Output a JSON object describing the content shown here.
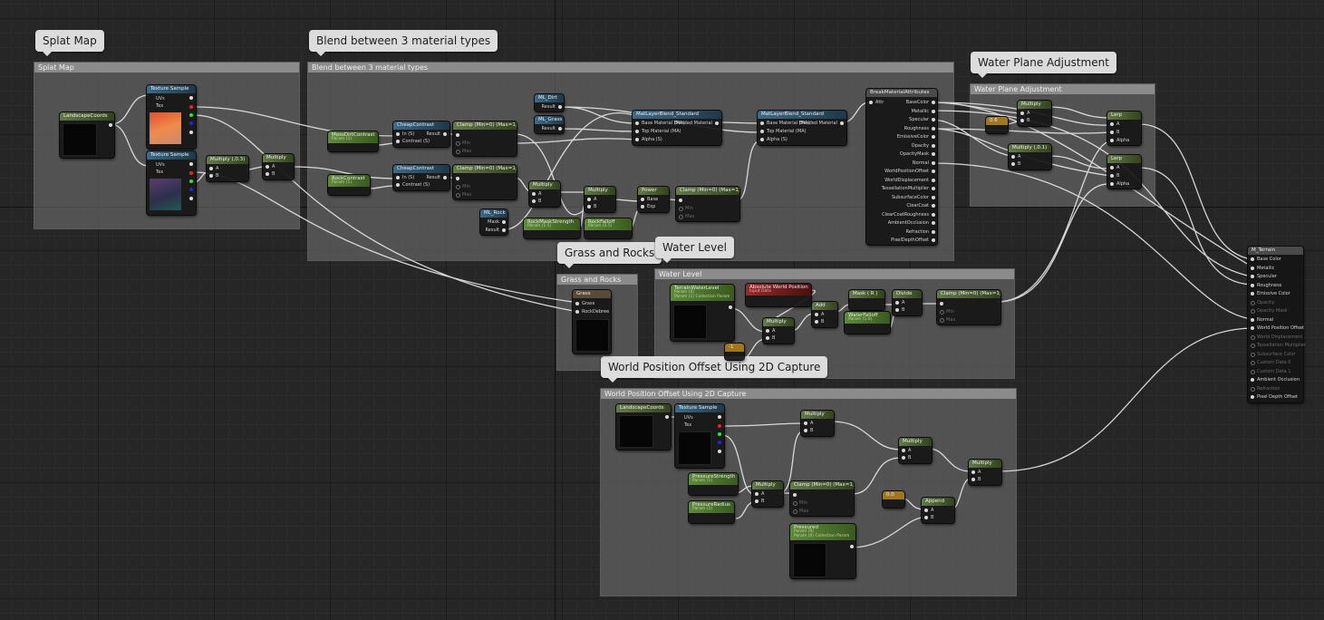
{
  "comments": [
    {
      "title": "Splat Map"
    },
    {
      "title": "Blend between 3 material types"
    },
    {
      "title": "Water Plane Adjustment"
    },
    {
      "title": "Grass and Rocks"
    },
    {
      "title": "Water Level"
    },
    {
      "title": "World Position Offset Using 2D Capture"
    }
  ],
  "nodes": {
    "landscape_coords_1": {
      "title": "LandscapeCoords"
    },
    "tex_sample_1": {
      "title": "Texture Sample",
      "pins": [
        "UVs",
        "Tex"
      ]
    },
    "tex_sample_2": {
      "title": "Texture Sample",
      "pins": [
        "UVs",
        "Tex"
      ]
    },
    "multiply_03": {
      "title": "Multiply (,0.3)",
      "pins": [
        "A",
        "B"
      ]
    },
    "multiply_splat": {
      "title": "Multiply",
      "pins": [
        "A",
        "B"
      ]
    },
    "moss_dirt_contrast": {
      "title": "MossDirtContrast",
      "sub": "Param (1)"
    },
    "rock_contrast": {
      "title": "RockContrast",
      "sub": "Param (1)"
    },
    "cheap_contrast_1": {
      "title": "CheapContrast",
      "pins": [
        "In (S)",
        "Contrast (S)"
      ],
      "out": "Result"
    },
    "cheap_contrast_2": {
      "title": "CheapContrast",
      "pins": [
        "In (S)",
        "Contrast (S)"
      ],
      "out": "Result"
    },
    "clamp_1": {
      "title": "Clamp (Min=0) (Max=1)",
      "pins": [
        "Min",
        "Max"
      ]
    },
    "clamp_2": {
      "title": "Clamp (Min=0) (Max=1)",
      "pins": [
        "Min",
        "Max"
      ]
    },
    "ml_dirt": {
      "title": "ML_Dirt",
      "out": "Result"
    },
    "ml_grass": {
      "title": "ML_Grass",
      "out": "Result"
    },
    "ml_rock": {
      "title": "ML_Rock",
      "pins": [
        "Mask",
        "Result"
      ]
    },
    "multiply_b1": {
      "title": "Multiply",
      "pins": [
        "A",
        "B"
      ]
    },
    "multiply_b2": {
      "title": "Multiply",
      "pins": [
        "A",
        "B"
      ]
    },
    "power": {
      "title": "Power",
      "pins": [
        "Base",
        "Exp"
      ]
    },
    "clamp_3": {
      "title": "Clamp (Min=0) (Max=1)",
      "pins": [
        "Min",
        "Max"
      ]
    },
    "rock_mask_strength": {
      "title": "RockMaskStrength",
      "sub": "Param (1.5)"
    },
    "rock_falloff": {
      "title": "RockFalloff",
      "sub": "Param (2.5)"
    },
    "mat_layer_blend_1": {
      "title": "MatLayerBlend_Standard",
      "pins": [
        "Base Material (MA)",
        "Top Material (MA)",
        "Alpha (S)"
      ],
      "out": "Blended Material"
    },
    "mat_layer_blend_2": {
      "title": "MatLayerBlend_Standard",
      "pins": [
        "Base Material (MA)",
        "Top Material (MA)",
        "Alpha (S)"
      ],
      "out": "Blended Material"
    },
    "break_material": {
      "title": "BreakMaterialAttributes",
      "in": "Attr",
      "pins": [
        "BaseColor",
        "Metallic",
        "Specular",
        "Roughness",
        "EmissiveColor",
        "Opacity",
        "OpacityMask",
        "Normal",
        "WorldPositionOffset",
        "WorldDisplacement",
        "TessellationMultiplier",
        "SubsurfaceColor",
        "ClearCoat",
        "ClearCoatRoughness",
        "AmbientOcclusion",
        "Refraction",
        "PixelDepthOffset"
      ]
    },
    "const_06": {
      "title": "0.6"
    },
    "multiply_w1": {
      "title": "Multiply",
      "pins": [
        "A",
        "B"
      ]
    },
    "multiply_w2": {
      "title": "Multiply (,0.1)",
      "pins": [
        "A",
        "B"
      ]
    },
    "lerp_1": {
      "title": "Lerp",
      "pins": [
        "A",
        "B",
        "Alpha"
      ]
    },
    "lerp_2": {
      "title": "Lerp",
      "pins": [
        "A",
        "B",
        "Alpha"
      ]
    },
    "m_terrain": {
      "title": "M_Terrain",
      "pins": [
        "Base Color",
        "Metallic",
        "Specular",
        "Roughness",
        "Emissive Color",
        "Opacity",
        "Opacity Mask",
        "Normal",
        "World Position Offset",
        "World Displacement",
        "Tessellation Multiplier",
        "Subsurface Color",
        "Custom Data 0",
        "Custom Data 1",
        "Ambient Occlusion",
        "Refraction",
        "Pixel Depth Offset"
      ]
    },
    "grass": {
      "title": "Grass",
      "pins": [
        "Grass",
        "RockDebree"
      ]
    },
    "terrain_water_level": {
      "title": "TerrainWaterLevel",
      "sub": "Param (0)",
      "sub2": "Param (1) Collection Param"
    },
    "abs_world_pos": {
      "title": "Absolute World Position",
      "sub": "Input Data"
    },
    "multiply_wl": {
      "title": "Multiply",
      "pins": [
        "A",
        "B"
      ]
    },
    "add": {
      "title": "Add",
      "pins": [
        "A",
        "B"
      ]
    },
    "mask_r": {
      "title": "Mask ( R )"
    },
    "divide": {
      "title": "Divide",
      "pins": [
        "A",
        "B"
      ]
    },
    "water_falloff": {
      "title": "WaterFalloff",
      "sub": "Param (1.6)"
    },
    "clamp_4": {
      "title": "Clamp (Min=0) (Max=1)",
      "pins": [
        "Min",
        "Max"
      ]
    },
    "const_neg1": {
      "title": "-1"
    },
    "landscape_coords_2": {
      "title": "LandscapeCoords"
    },
    "tex_sample_3": {
      "title": "Texture Sample",
      "pins": [
        "UVs",
        "Tex"
      ]
    },
    "pressure_strength": {
      "title": "PressureStrength",
      "sub": "Param (1)"
    },
    "pressure_radius": {
      "title": "PressureRadius",
      "sub": "Param (1)"
    },
    "multiply_p1": {
      "title": "Multiply",
      "pins": [
        "A",
        "B"
      ]
    },
    "multiply_p2": {
      "title": "Multiply",
      "pins": [
        "A",
        "B"
      ]
    },
    "multiply_p3": {
      "title": "Multiply",
      "pins": [
        "A",
        "B"
      ]
    },
    "multiply_p4": {
      "title": "Multiply",
      "pins": [
        "A",
        "B"
      ]
    },
    "clamp_5": {
      "title": "Clamp (Min=0) (Max=1)",
      "pins": [
        "Min",
        "Max"
      ]
    },
    "const_00": {
      "title": "0.0"
    },
    "append": {
      "title": "Append",
      "pins": [
        "A",
        "B"
      ]
    },
    "pressured": {
      "title": "Pressured",
      "sub": "Param (0)",
      "sub2": "Param (0) Collection Param"
    }
  }
}
